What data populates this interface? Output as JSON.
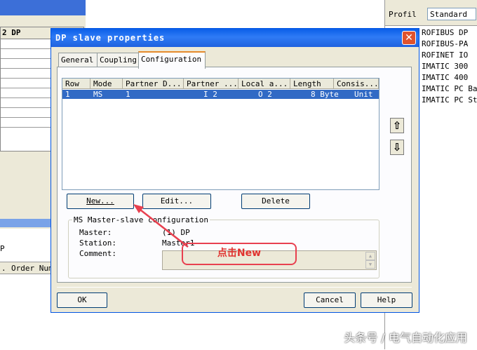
{
  "background_left": {
    "table_header": "2 DP",
    "bottom_dp": "P",
    "bottom_col1": ".",
    "bottom_col2": "Order Num"
  },
  "catalog": {
    "profile_label": "Profil",
    "profile_value": "Standard",
    "items": [
      "ROFIBUS DP",
      "ROFIBUS-PA",
      "ROFINET IO",
      "IMATIC 300",
      "IMATIC 400",
      "IMATIC PC Base",
      "IMATIC PC Sta"
    ]
  },
  "dialog": {
    "title": "DP slave properties",
    "close_glyph": "✕",
    "tabs": [
      "General",
      "Coupling",
      "Configuration"
    ],
    "active_tab": "Configuration",
    "table": {
      "columns": [
        "Row",
        "Mode",
        "Partner D...",
        "Partner ...",
        "Local a...",
        "Length",
        "Consis..."
      ],
      "rows": [
        [
          "1",
          "MS",
          "1",
          "I 2",
          "O 2",
          "8 Byte",
          "Unit"
        ]
      ]
    },
    "move_up_glyph": "⇧",
    "move_down_glyph": "⇩",
    "buttons": {
      "new": "New...",
      "edit": "Edit...",
      "delete": "Delete",
      "ok": "OK",
      "cancel": "Cancel",
      "help": "Help"
    },
    "group": {
      "title": "MS Master-slave configuration",
      "master_label": "Master:",
      "master_value": "(1) DP",
      "station_label": "Station:",
      "station_value": "Master1",
      "comment_label": "Comment:"
    }
  },
  "annotation": {
    "callout_text": "点击New",
    "color": "#e8404f"
  },
  "watermark": "头条号 / 电气自动化应用"
}
